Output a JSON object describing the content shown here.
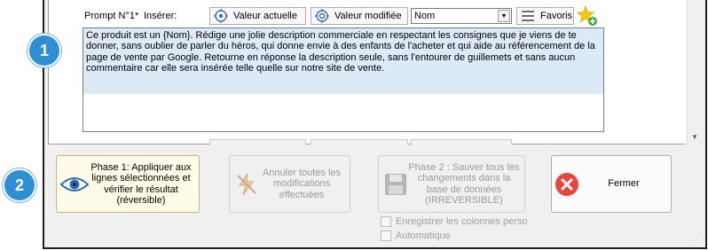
{
  "prompt": {
    "label": "Prompt N°1*",
    "insert_label": "Insérer:",
    "current_value_button": "Valeur actuelle",
    "modified_value_button": "Valeur modifiée",
    "field_select": {
      "selected": "Nom"
    },
    "favorites_button": "Favoris",
    "text": "Ce produit est un {Nom}. Rédige une jolie description commerciale en respectant les consignes que je viens de te donner, sans oublier de parler du héros, qui donne envie à des enfants de l'acheter et qui aide au référencement de la page de vente par Google. Retourne en réponse la description seule, sans l'entourer de guillemets et sans aucun commentaire car elle sera insérée telle quelle sur notre site de vente."
  },
  "badges": {
    "first": "1",
    "second": "2"
  },
  "actions": {
    "phase1": "Phase 1: Appliquer aux lignes sélectionnées et vérifier le résultat (réversible)",
    "undo": "Annuler toutes les modifications effectuées",
    "phase2": "Phase 2 : Sauver tous les changements dans la base de données (IRREVERSIBLE)",
    "close": "Fermer"
  },
  "options": {
    "save_custom_columns": "Enregistrer les colonnes perso",
    "automatic": "Automatique"
  },
  "colors": {
    "badge": "#2e8fd6",
    "close_icon": "#e8453c",
    "favorite_star": "#f5c518"
  }
}
